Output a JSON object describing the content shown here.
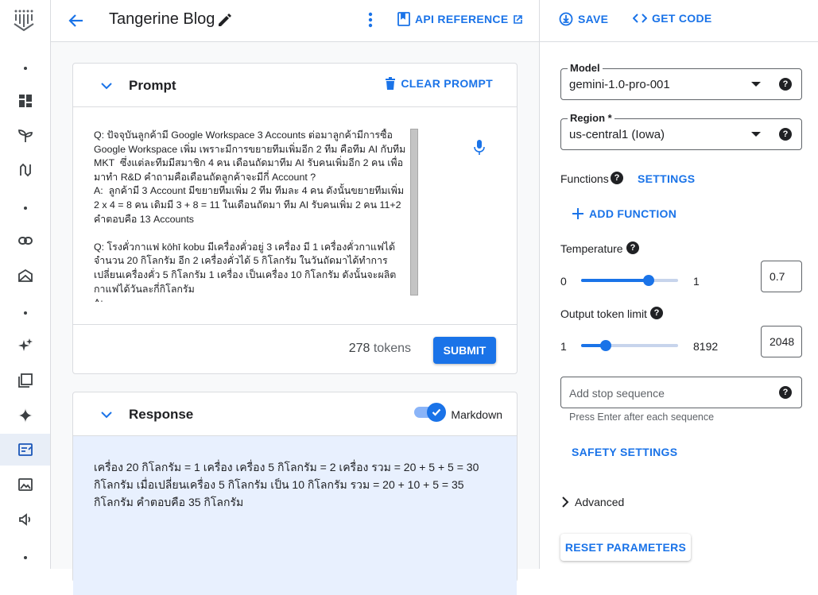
{
  "header": {
    "title": "Tangerine Blog",
    "api_reference": "API REFERENCE",
    "save": "SAVE",
    "get_code": "GET CODE"
  },
  "prompt": {
    "heading": "Prompt",
    "clear_label": "CLEAR PROMPT",
    "text": "Q: ปัจจุบันลูกค้ามี Google Workspace 3 Accounts ต่อมาลูกค้ามีการซื้อ Google Workspace เพิ่ม เพราะมีการขยายทีมเพิ่มอีก 2 ทีม คือทีม AI กับทีม MKT  ซึ่งแต่ละทีมมีสมาชิก 4 คน เดือนถัดมาทีม AI รับคนเพิ่มอีก 2 คน เพื่อมาทำ R&D คำถามคือเดือนถัดลูกค้าจะมีกี่ Account ?\nA:  ลูกค้ามี 3 Account มีขยายทีมเพิ่ม 2 ทีม ทีมละ 4 คน ดังนั้นขยายทีมเพิ่ม 2 x 4 = 8 คน เดิมมี 3 + 8 = 11 ในเดือนถัดมา ทีม AI รับคนเพิ่ม 2 คน 11+2 คำตอบคือ 13 Accounts\n\nQ: โรงคั่วกาแฟ kōhī kobu มีเครื่องคั่วอยู่ 3 เครื่อง มี 1 เครื่องคั่วกาแฟได้จำนวน 20 กิโลกรัม อีก 2 เครื่องคั่วได้ 5 กิโลกรัม ในวันถัดมาได้ทำการเปลี่ยนเครื่องคั่ว 5 กิโลกรัม 1 เครื่อง เป็นเครื่อง 10 กิโลกรัม ดังนั้นจะผลิตกาแฟได้วันละกี่กิโลกรัม\nA:",
    "token_count": "278",
    "tokens_label": "tokens",
    "submit_label": "SUBMIT"
  },
  "response": {
    "heading": "Response",
    "markdown_label": "Markdown",
    "markdown_enabled": true,
    "text": "เครื่อง 20 กิโลกรัม = 1 เครื่อง เครื่อง 5 กิโลกรัม = 2 เครื่อง รวม = 20 + 5 + 5 = 30 กิโลกรัม เมื่อเปลี่ยนเครื่อง 5 กิโลกรัม เป็น 10 กิโลกรัม รวม = 20 + 10 + 5 = 35 กิโลกรัม คำตอบคือ 35 กิโลกรัม"
  },
  "settings": {
    "model_label": "Model",
    "model_value": "gemini-1.0-pro-001",
    "region_label": "Region *",
    "region_value": "us-central1 (Iowa)",
    "functions_label": "Functions",
    "settings_link": "SETTINGS",
    "add_function": "ADD FUNCTION",
    "temperature_label": "Temperature",
    "temperature_min": "0",
    "temperature_max": "1",
    "temperature_value": "0.7",
    "temperature_fraction": 0.7,
    "token_limit_label": "Output token limit",
    "token_min": "1",
    "token_max": "8192",
    "token_value": "2048",
    "token_fraction": 0.25,
    "stop_placeholder": "Add stop sequence",
    "stop_hint": "Press Enter after each sequence",
    "safety_settings": "SAFETY SETTINGS",
    "advanced": "Advanced",
    "reset": "RESET PARAMETERS"
  },
  "colors": {
    "accent": "#1a73e8",
    "response_bg": "#e8f0fe",
    "main_bg": "#f8f9fa"
  }
}
